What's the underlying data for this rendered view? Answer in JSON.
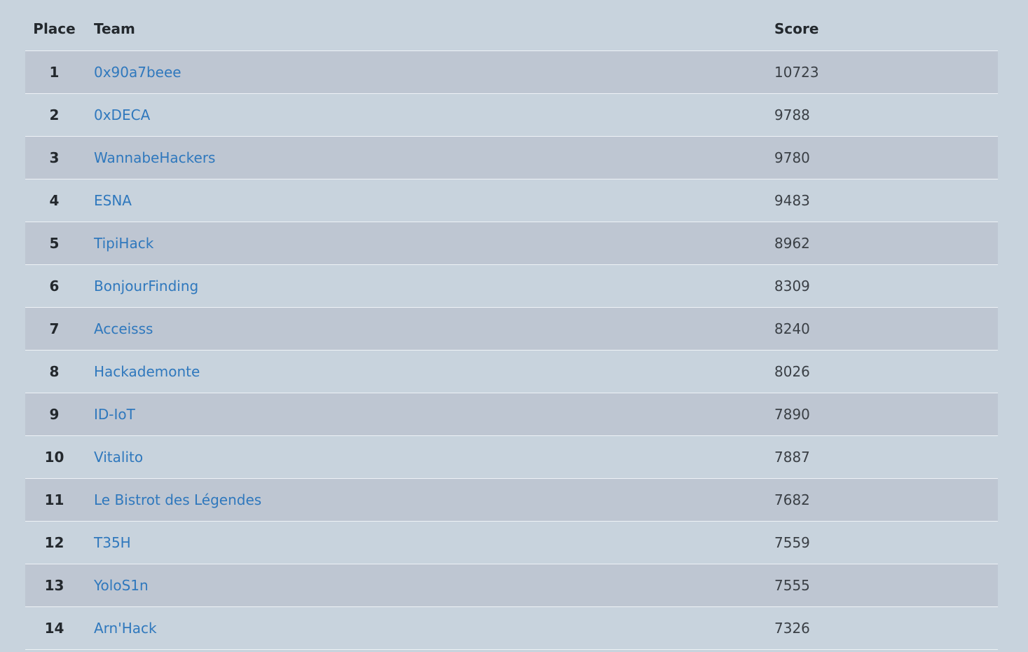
{
  "scoreboard": {
    "headers": {
      "place": "Place",
      "team": "Team",
      "score": "Score"
    },
    "rows": [
      {
        "place": "1",
        "team": "0x90a7beee",
        "score": "10723"
      },
      {
        "place": "2",
        "team": "0xDECA",
        "score": "9788"
      },
      {
        "place": "3",
        "team": "WannabeHackers",
        "score": "9780"
      },
      {
        "place": "4",
        "team": "ESNA",
        "score": "9483"
      },
      {
        "place": "5",
        "team": "TipiHack",
        "score": "8962"
      },
      {
        "place": "6",
        "team": "BonjourFinding",
        "score": "8309"
      },
      {
        "place": "7",
        "team": "Acceisss",
        "score": "8240"
      },
      {
        "place": "8",
        "team": "Hackademonte",
        "score": "8026"
      },
      {
        "place": "9",
        "team": "ID-IoT",
        "score": "7890"
      },
      {
        "place": "10",
        "team": "Vitalito",
        "score": "7887"
      },
      {
        "place": "11",
        "team": "Le Bistrot des Légendes",
        "score": "7682"
      },
      {
        "place": "12",
        "team": "T35H",
        "score": "7559"
      },
      {
        "place": "13",
        "team": "YoloS1n",
        "score": "7555"
      },
      {
        "place": "14",
        "team": "Arn'Hack",
        "score": "7326"
      }
    ]
  },
  "colors": {
    "background": "#c8d3dd",
    "stripe": "#bec6d2",
    "link": "#2f78bd",
    "text": "#23282d"
  }
}
